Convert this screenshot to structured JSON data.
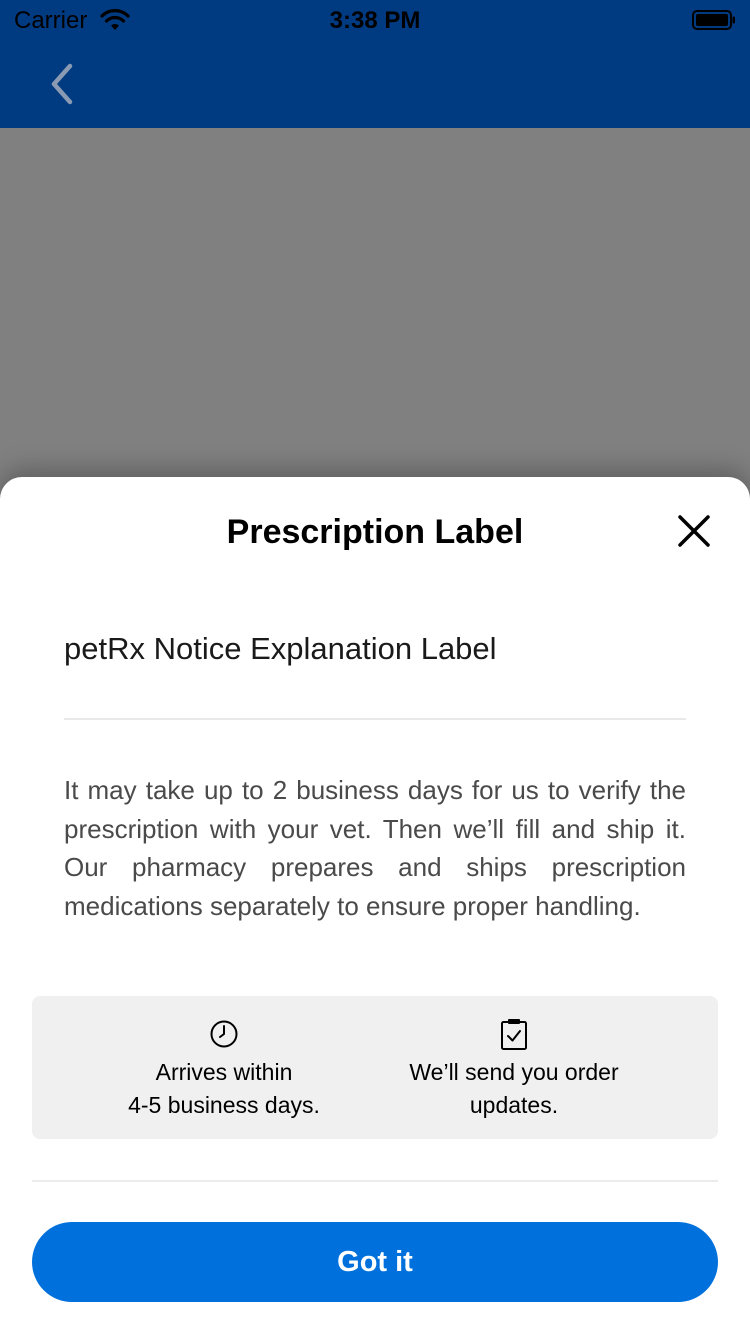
{
  "status_bar": {
    "carrier": "Carrier",
    "time": "3:38 PM",
    "wifi_icon": "wifi-icon",
    "battery_icon": "battery-icon"
  },
  "nav": {
    "back_icon": "chevron-left-icon",
    "background_color": "#003a80"
  },
  "sheet": {
    "title": "Prescription Label",
    "close_icon": "close-icon",
    "subtitle": "petRx Notice Explanation Label",
    "body": "It may take up to 2 business days for us to verify the prescription with your vet. Then we’ll fill and ship it. Our pharmacy prepares and ships prescription medications separately to ensure proper handling.",
    "info": {
      "delivery": {
        "icon": "clock-icon",
        "line1": "Arrives within",
        "line2": "4-5 business days."
      },
      "updates": {
        "icon": "clipboard-check-icon",
        "line1": "We’ll send you order",
        "line2": "updates."
      }
    },
    "button_label": "Got it",
    "button_color": "#0071dc"
  }
}
